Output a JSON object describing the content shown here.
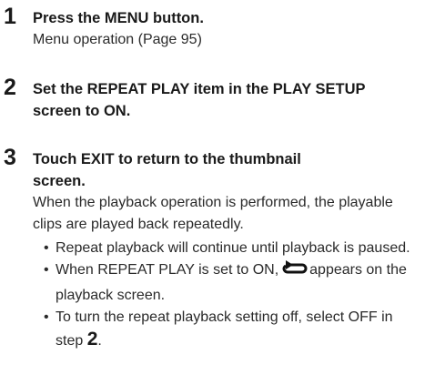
{
  "steps": [
    {
      "number": "1",
      "title": "Press the MENU button.",
      "body": "Menu operation (Page 95)"
    },
    {
      "number": "2",
      "title": "Set the REPEAT PLAY item in the PLAY SETUP screen to ON."
    },
    {
      "number": "3",
      "title": "Touch EXIT to return to the thumbnail screen.",
      "body": "When the playback operation is performed, the playable clips are played back repeatedly.",
      "bullets": {
        "b1": "Repeat playback will continue until playback is paused.",
        "b2_before": "When REPEAT PLAY is set to ON,",
        "b2_after": "appears on the playback screen.",
        "b2_icon": "repeat-icon",
        "b3_before": "To turn the repeat playback setting off, select OFF in step",
        "b3_step_ref": "2",
        "b3_after": "."
      }
    }
  ]
}
